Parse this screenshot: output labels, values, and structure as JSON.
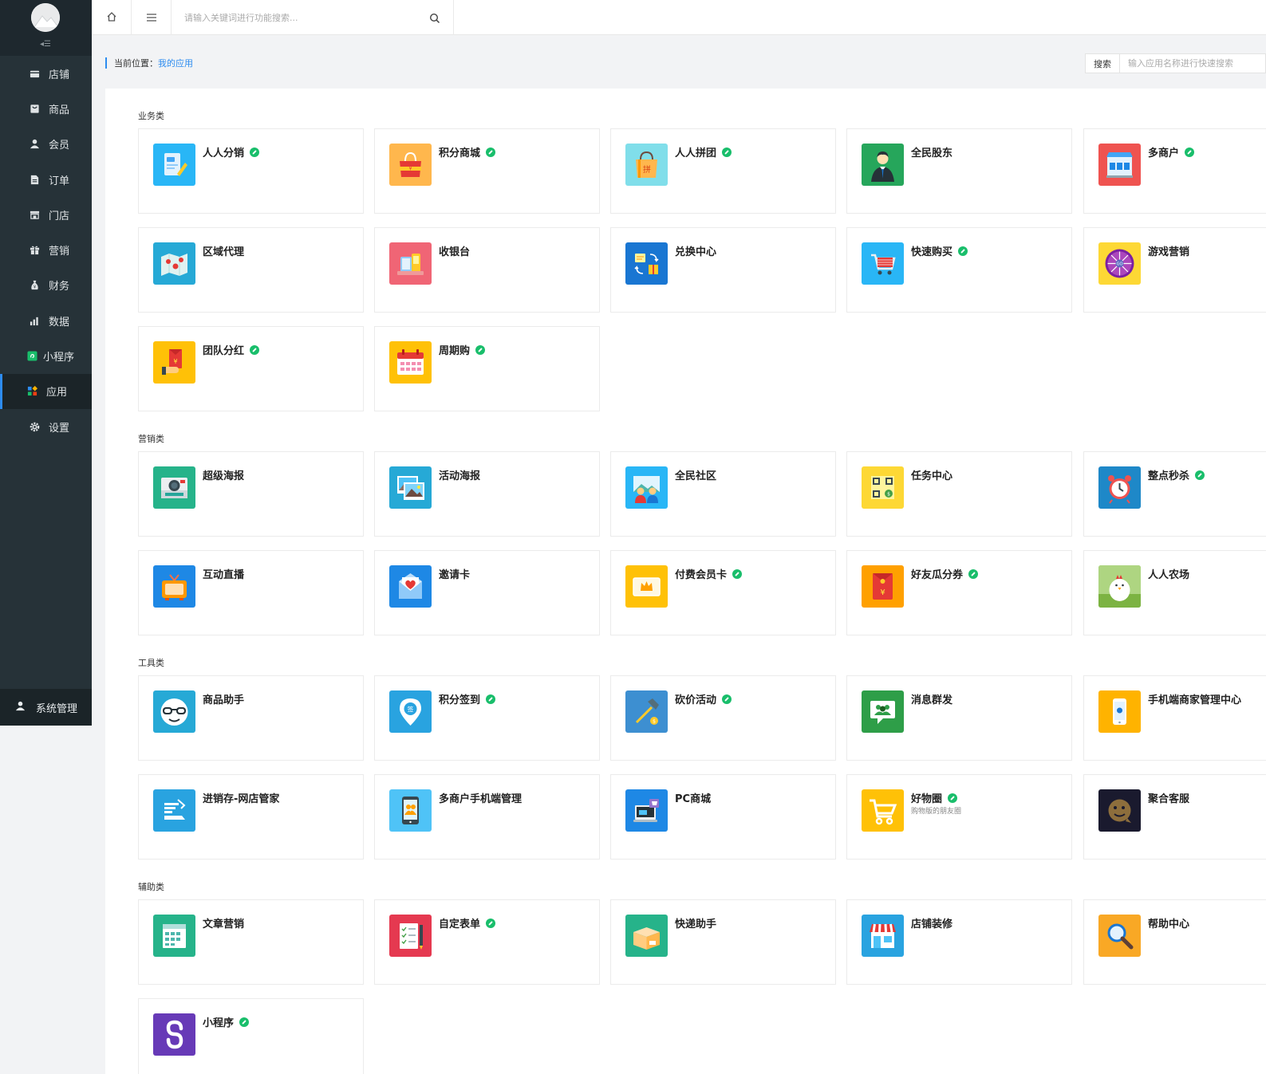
{
  "sidebar": {
    "items": [
      {
        "label": "店铺",
        "icon": "store-icon"
      },
      {
        "label": "商品",
        "icon": "goods-icon"
      },
      {
        "label": "会员",
        "icon": "user-icon"
      },
      {
        "label": "订单",
        "icon": "order-icon"
      },
      {
        "label": "门店",
        "icon": "shop-icon"
      },
      {
        "label": "营销",
        "icon": "gift-icon"
      },
      {
        "label": "财务",
        "icon": "money-bag-icon"
      },
      {
        "label": "数据",
        "icon": "bar-chart-icon"
      },
      {
        "label": "小程序",
        "icon": "miniprogram-icon"
      },
      {
        "label": "应用",
        "icon": "apps-grid-icon",
        "active": true
      },
      {
        "label": "设置",
        "icon": "gear-icon"
      }
    ],
    "system_label": "系统管理"
  },
  "header": {
    "search_placeholder": "请输入关键词进行功能搜索..."
  },
  "breadcrumb": {
    "prefix": "当前位置：",
    "current": "我的应用"
  },
  "quick_search": {
    "button": "搜索",
    "placeholder": "输入应用名称进行快速搜索"
  },
  "sections": [
    {
      "title": "业务类",
      "apps": [
        {
          "name": "人人分销",
          "badge": true,
          "color": "#29b6f6",
          "icon": "distribution-icon"
        },
        {
          "name": "积分商城",
          "badge": true,
          "color": "#ffb74d",
          "icon": "points-mall-icon"
        },
        {
          "name": "人人拼团",
          "badge": true,
          "color": "#80deea",
          "icon": "group-buy-icon"
        },
        {
          "name": "全民股东",
          "badge": false,
          "color": "#26a65b",
          "icon": "shareholder-icon"
        },
        {
          "name": "多商户",
          "badge": true,
          "color": "#ef5350",
          "icon": "multi-merchant-icon"
        },
        {
          "name": "区域代理",
          "badge": false,
          "color": "#26a9d6",
          "icon": "region-map-icon"
        },
        {
          "name": "收银台",
          "badge": false,
          "color": "#f06575",
          "icon": "cashier-icon"
        },
        {
          "name": "兑换中心",
          "badge": false,
          "color": "#1976d2",
          "icon": "exchange-icon"
        },
        {
          "name": "快速购买",
          "badge": true,
          "color": "#29b6f6",
          "icon": "cart-icon"
        },
        {
          "name": "游戏营销",
          "badge": false,
          "color": "#fdd835",
          "icon": "wheel-icon"
        },
        {
          "name": "团队分红",
          "badge": true,
          "color": "#ffc107",
          "icon": "red-envelope-icon"
        },
        {
          "name": "周期购",
          "badge": true,
          "color": "#ffc107",
          "icon": "calendar-icon"
        }
      ]
    },
    {
      "title": "营销类",
      "apps": [
        {
          "name": "超级海报",
          "badge": false,
          "color": "#26b38a",
          "icon": "camera-icon"
        },
        {
          "name": "活动海报",
          "badge": false,
          "color": "#26a9d6",
          "icon": "photo-icon"
        },
        {
          "name": "全民社区",
          "badge": false,
          "color": "#29b6f6",
          "icon": "community-icon"
        },
        {
          "name": "任务中心",
          "badge": false,
          "color": "#fdd835",
          "icon": "qrcode-icon"
        },
        {
          "name": "整点秒杀",
          "badge": true,
          "color": "#1e88c8",
          "icon": "alarm-clock-icon"
        },
        {
          "name": "互动直播",
          "badge": false,
          "color": "#1e88e5",
          "icon": "tv-icon"
        },
        {
          "name": "邀请卡",
          "badge": false,
          "color": "#1e88e5",
          "icon": "invite-card-icon"
        },
        {
          "name": "付费会员卡",
          "badge": true,
          "color": "#ffc107",
          "icon": "vip-card-icon"
        },
        {
          "name": "好友瓜分券",
          "badge": true,
          "color": "#ffa000",
          "icon": "coupon-envelope-icon"
        },
        {
          "name": "人人农场",
          "badge": false,
          "color": "#8bc34a",
          "icon": "chicken-icon"
        }
      ]
    },
    {
      "title": "工具类",
      "apps": [
        {
          "name": "商品助手",
          "badge": false,
          "color": "#26a9d6",
          "icon": "glasses-icon"
        },
        {
          "name": "积分签到",
          "badge": true,
          "color": "#29a3e0",
          "icon": "sign-in-pin-icon"
        },
        {
          "name": "砍价活动",
          "badge": true,
          "color": "#3d8fd1",
          "icon": "axe-icon"
        },
        {
          "name": "消息群发",
          "badge": false,
          "color": "#2e9e48",
          "icon": "message-icon"
        },
        {
          "name": "手机端商家管理中心",
          "badge": false,
          "color": "#ffb300",
          "icon": "phone-icon"
        },
        {
          "name": "进销存-网店管家",
          "badge": false,
          "color": "#29a3e0",
          "icon": "inventory-icon"
        },
        {
          "name": "多商户手机端管理",
          "badge": false,
          "color": "#4fc3f7",
          "icon": "mobile-merchant-icon"
        },
        {
          "name": "PC商城",
          "badge": false,
          "color": "#1e88e5",
          "icon": "pc-mall-icon"
        },
        {
          "name": "好物圈",
          "badge": true,
          "sub": "购物版的朋友圈",
          "color": "#ffc107",
          "icon": "shopping-circle-icon"
        },
        {
          "name": "聚合客服",
          "badge": false,
          "color": "#1a1a2e",
          "icon": "customer-service-icon"
        }
      ]
    },
    {
      "title": "辅助类",
      "apps": [
        {
          "name": "文章营销",
          "badge": false,
          "color": "#26b38a",
          "icon": "article-icon"
        },
        {
          "name": "自定表单",
          "badge": true,
          "color": "#e53950",
          "icon": "form-icon"
        },
        {
          "name": "快递助手",
          "badge": false,
          "color": "#26b38a",
          "icon": "package-icon"
        },
        {
          "name": "店铺装修",
          "badge": false,
          "color": "#29a3e0",
          "icon": "shop-decor-icon"
        },
        {
          "name": "帮助中心",
          "badge": false,
          "color": "#f9a825",
          "icon": "magnifier-icon"
        },
        {
          "name": "小程序",
          "badge": true,
          "color": "#673ab7",
          "icon": "miniprogram-logo-icon"
        }
      ]
    }
  ]
}
